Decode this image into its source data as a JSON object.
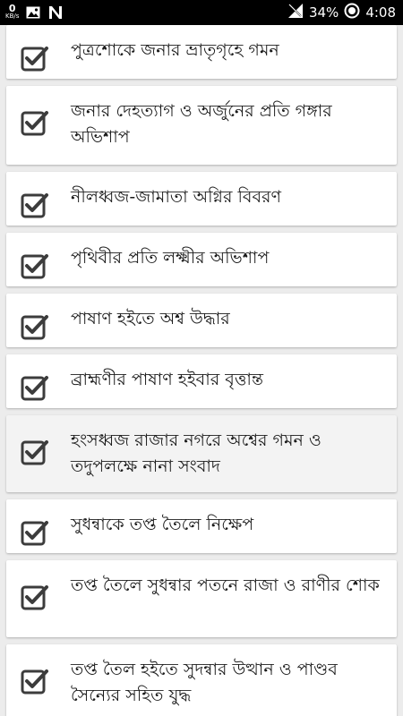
{
  "status_bar": {
    "net_speed_value": "0",
    "net_speed_unit": "KB/s",
    "battery_percent": "34%",
    "time": "4:08",
    "icons": [
      "image-icon",
      "n-app-icon",
      "signal-icon",
      "battery-icon"
    ]
  },
  "colors": {
    "background": "#ececec",
    "card": "#ffffff",
    "card_selected": "#f3f3f3",
    "checkbox": "#3c3c3c",
    "text": "#1a1a1a"
  },
  "items": [
    {
      "title": "পুত্রশোকে জনার ভ্রাতৃগৃহে গমন",
      "checked": true
    },
    {
      "title": "জনার দেহত্যাগ ও অর্জুনের প্রতি গঙ্গার অভিশাপ",
      "checked": true
    },
    {
      "title": "নীলধ্বজ-জামাতা অগ্নির বিবরণ",
      "checked": true
    },
    {
      "title": "পৃথিবীর প্রতি লক্ষ্মীর অভিশাপ",
      "checked": true
    },
    {
      "title": "পাষাণ হইতে অশ্ব উদ্ধার",
      "checked": true
    },
    {
      "title": "ব্রাহ্মণীর পাষাণ হইবার বৃত্তান্ত",
      "checked": true
    },
    {
      "title": "হংসধ্বজ রাজার নগরে অশ্বের গমন ও তদুপলক্ষে নানা সংবাদ",
      "checked": true
    },
    {
      "title": "সুধন্বাকে তপ্ত তৈলে নিক্ষেপ",
      "checked": true
    },
    {
      "title": "তপ্ত তৈলে সুধন্বার পতনে রাজা ও রাণীর শোক",
      "checked": true
    },
    {
      "title": "তপ্ত তৈল হইতে সুদন্বার উত্থান ও পাণ্ডব সৈন্যের সহিত যুদ্ধ",
      "checked": true
    }
  ]
}
